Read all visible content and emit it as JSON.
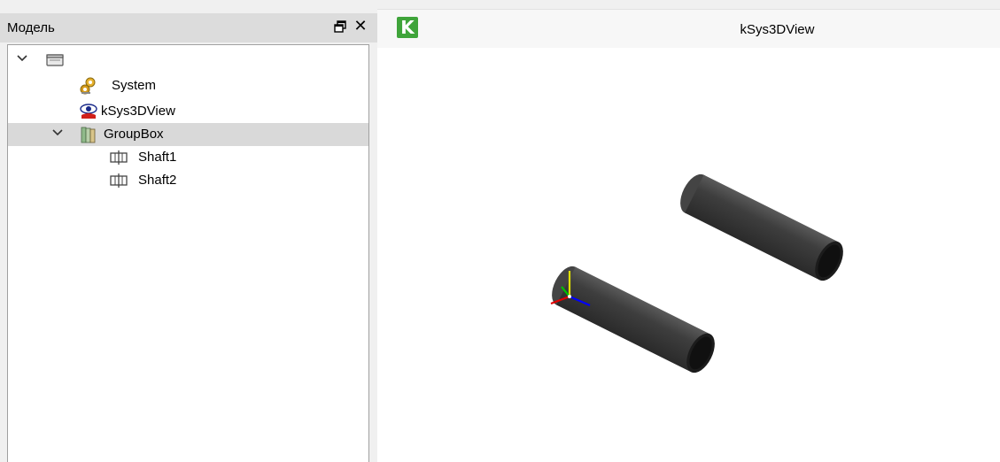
{
  "dock": {
    "title": "Модель",
    "float_icon": "float-window-icon",
    "close_icon": "close-icon"
  },
  "tree": {
    "root": {
      "label": "",
      "icon": "folder-icon",
      "expanded": true
    },
    "items": [
      {
        "label": "System",
        "icon": "system-gears-icon"
      },
      {
        "label": "kSys3DView",
        "icon": "3d-view-eye-icon"
      },
      {
        "label": "GroupBox",
        "icon": "groupbox-books-icon",
        "expanded": true,
        "selected": true
      },
      {
        "label": "Shaft1",
        "icon": "shaft-icon"
      },
      {
        "label": "Shaft2",
        "icon": "shaft-icon"
      }
    ]
  },
  "view": {
    "logo_letter": "K",
    "title": "kSys3DView",
    "accent": "#3fa43a"
  },
  "scene": {
    "objects": [
      "Shaft1",
      "Shaft2"
    ],
    "axes": {
      "x_color": "#0000ff",
      "y_color": "#e0e000",
      "z_color": "#00c000",
      "extra_color": "#e00000"
    }
  }
}
